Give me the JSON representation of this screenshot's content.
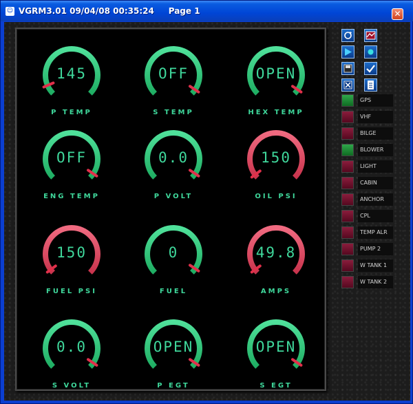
{
  "window": {
    "title": "VGRM3.01 09/04/08 00:35:24     Page 1",
    "icon": "app-icon",
    "close_label": "✕"
  },
  "colors": {
    "normal": "#1fae63",
    "alarm": "#c9344d",
    "display": "#3fd79b",
    "switch_on": "#1e8c35",
    "switch_off": "#6e1230"
  },
  "gauges": [
    {
      "label": "P TEMP",
      "value": "145",
      "state": "normal",
      "needle_fraction": 0.08
    },
    {
      "label": "S TEMP",
      "value": "OFF",
      "state": "normal",
      "needle_fraction": 0.96
    },
    {
      "label": "HEX TEMP",
      "value": "OPEN",
      "state": "normal",
      "needle_fraction": 0.96
    },
    {
      "label": "ENG TEMP",
      "value": "OFF",
      "state": "normal",
      "needle_fraction": 0.96
    },
    {
      "label": "P VOLT",
      "value": "0.0",
      "state": "normal",
      "needle_fraction": 0.96
    },
    {
      "label": "OIL PSI",
      "value": "150",
      "state": "alarm",
      "needle_fraction": 0.03
    },
    {
      "label": "FUEL PSI",
      "value": "150",
      "state": "alarm",
      "needle_fraction": 0.03
    },
    {
      "label": "FUEL",
      "value": "0",
      "state": "normal",
      "needle_fraction": 0.96
    },
    {
      "label": "AMPS",
      "value": "49.8",
      "state": "alarm",
      "needle_fraction": 0.03
    },
    {
      "label": "S VOLT",
      "value": "0.0",
      "state": "normal",
      "needle_fraction": 0.96
    },
    {
      "label": "P EGT",
      "value": "OPEN",
      "state": "normal",
      "needle_fraction": 0.96
    },
    {
      "label": "S EGT",
      "value": "OPEN",
      "state": "normal",
      "needle_fraction": 0.96
    }
  ],
  "toolbar": [
    {
      "icon": "refresh-icon"
    },
    {
      "icon": "chart-icon"
    },
    {
      "icon": "play-icon"
    },
    {
      "icon": "record-icon"
    },
    {
      "icon": "save-icon"
    },
    {
      "icon": "check-icon"
    },
    {
      "icon": "cancel-icon"
    },
    {
      "icon": "document-icon"
    }
  ],
  "switches": [
    {
      "label": "GPS",
      "on": true
    },
    {
      "label": "VHF",
      "on": false
    },
    {
      "label": "BILGE",
      "on": false
    },
    {
      "label": "BLOWER",
      "on": true
    },
    {
      "label": "LIGHT",
      "on": false
    },
    {
      "label": "CABIN",
      "on": false
    },
    {
      "label": "ANCHOR",
      "on": false
    },
    {
      "label": "CPL",
      "on": false
    },
    {
      "label": "TEMP ALR",
      "on": false
    },
    {
      "label": "PUMP 2",
      "on": false
    },
    {
      "label": "W TANK 1",
      "on": false
    },
    {
      "label": "W TANK 2",
      "on": false
    }
  ]
}
